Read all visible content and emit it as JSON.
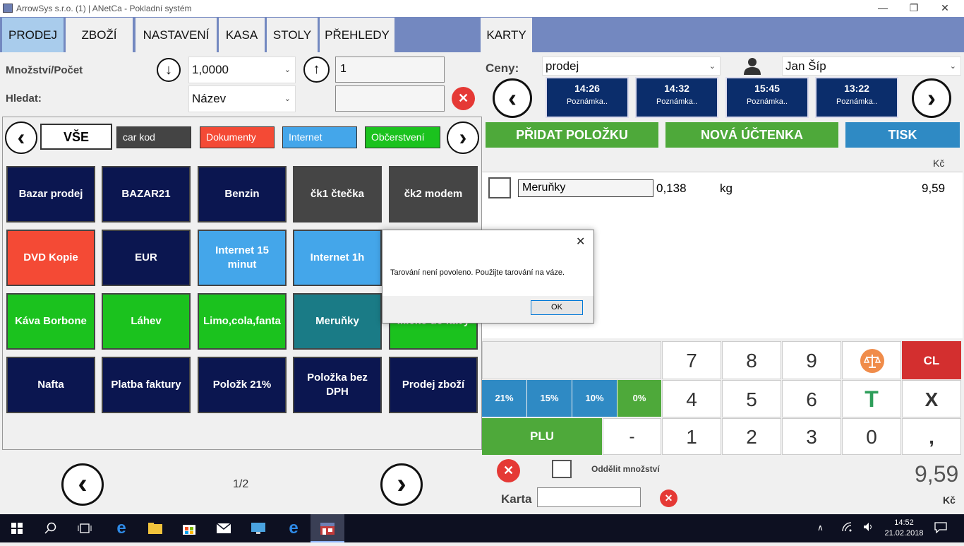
{
  "window": {
    "title": "ArrowSys s.r.o. (1) | ANetCa - Pokladní systém",
    "minimize": "—",
    "restore": "❐",
    "close": "✕"
  },
  "tabs": [
    {
      "label": "PRODEJ"
    },
    {
      "label": "ZBOŽÍ"
    },
    {
      "label": "NASTAVENÍ"
    },
    {
      "label": "KASA"
    },
    {
      "label": "STOLY"
    },
    {
      "label": "PŘEHLEDY"
    },
    {
      "label": "KARTY"
    }
  ],
  "left": {
    "qty_label": "Množství/Počet",
    "qty_value": "1,0000",
    "count_value": "1",
    "search_label": "Hledat:",
    "search_by": "Název",
    "search_value": "",
    "down_arrow": "↓",
    "up_arrow": "↑",
    "clear_x": "✕",
    "categories": [
      {
        "label": "VŠE"
      },
      {
        "label": "car kod"
      },
      {
        "label": "Dokumenty"
      },
      {
        "label": "Internet"
      },
      {
        "label": "Občerstvení"
      }
    ],
    "prev": "‹",
    "next": "›",
    "tiles": [
      "Bazar prodej",
      "BAZAR21",
      "Benzin",
      "čk1 čtečka",
      "čk2 modem",
      "DVD Kopie",
      "EUR",
      "Internet 15 minut",
      "Internet 1h",
      "",
      "Káva Borbone",
      "Láhev",
      "Limo,cola,fanta",
      "Meruňky",
      "Mléko do kávy",
      "Nafta",
      "Platba faktury",
      "Položk 21%",
      "Položka bez DPH",
      "Prodej zboží"
    ],
    "page": "1/2"
  },
  "right": {
    "price_label": "Ceny:",
    "price_value": "prodej",
    "user": "Jan  Šíp",
    "tickets": [
      {
        "time": "14:26",
        "note": "Poznámka.."
      },
      {
        "time": "14:32",
        "note": "Poznámka.."
      },
      {
        "time": "15:45",
        "note": "Poznámka.."
      },
      {
        "time": "13:22",
        "note": "Poznámka.."
      }
    ],
    "add_item": "PŘIDAT POLOŽKU",
    "new_receipt": "NOVÁ ÚČTENKA",
    "print": "TISK",
    "currency": "Kč",
    "items": [
      {
        "name": "Meruňky",
        "qty": "0,138",
        "unit": "kg",
        "price": "9,59"
      }
    ],
    "keys": {
      "k7": "7",
      "k8": "8",
      "k9": "9",
      "cl": "CL",
      "k4": "4",
      "k5": "5",
      "k6": "6",
      "t": "T",
      "x": "X",
      "k1": "1",
      "k2": "2",
      "k3": "3",
      "k0": "0",
      "minus": "-",
      "comma": ","
    },
    "vat": [
      "21%",
      "15%",
      "10%",
      "0%"
    ],
    "plu": "PLU",
    "split_qty": "Oddělit množství",
    "total": "9,59",
    "total_currency": "Kč",
    "card_label": "Karta",
    "card_value": ""
  },
  "dialog": {
    "message": "Tarování není povoleno. Použijte tarování na váze.",
    "ok": "OK",
    "close": "✕"
  },
  "taskbar": {
    "time": "14:52",
    "date": "21.02.2018"
  },
  "colors": {
    "navy": "#0b1650",
    "menubar": "#7388c0",
    "green": "#4ea93a",
    "tisk": "#2f8ac4",
    "cl": "#d32f2f"
  }
}
